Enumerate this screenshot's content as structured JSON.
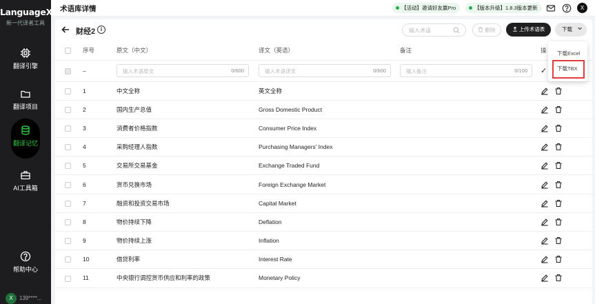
{
  "sidebar": {
    "logo": "LanguageX",
    "tagline": "新一代译者工具",
    "items": [
      {
        "label": "翻译引擎",
        "icon": "engine-icon"
      },
      {
        "label": "翻译项目",
        "icon": "folder-icon"
      },
      {
        "label": "翻译记忆",
        "icon": "database-icon"
      },
      {
        "label": "AI工具箱",
        "icon": "toolbox-icon"
      }
    ],
    "help": "帮助中心",
    "user": {
      "initial": "X",
      "name": "139****..."
    }
  },
  "topbar": {
    "title": "术语库详情",
    "pill1": "【活动】邀请好友赢Pro",
    "pill2": "【版本升级】1.8.3版本更新",
    "avatar": "X"
  },
  "page": {
    "title": "财经2"
  },
  "toolbar": {
    "search_placeholder": "输入术语",
    "delete_label": "删除",
    "upload_label": "上传术语表",
    "download_label": "下载"
  },
  "dropdown": {
    "excel": "下载Excel",
    "tbx": "下载TBX"
  },
  "table": {
    "headers": {
      "index": "序号",
      "source": "原文（中文）",
      "target": "译文（英语）",
      "note": "备注",
      "ops": "操"
    },
    "new_row": {
      "index": "–",
      "source_placeholder": "输入术语原文",
      "source_count": "0/600",
      "target_placeholder": "输入术语译文",
      "target_count": "0/600",
      "note_placeholder": "输入备注",
      "note_count": "0/100"
    },
    "rows": [
      {
        "index": "1",
        "source": "中文全称",
        "target": "英文全称"
      },
      {
        "index": "2",
        "source": "国内生产总值",
        "target": "Gross Domestic Product"
      },
      {
        "index": "3",
        "source": "消费者价格指数",
        "target": "Consumer Price Index"
      },
      {
        "index": "4",
        "source": "采购经理人指数",
        "target": "Purchasing Managers' Index"
      },
      {
        "index": "5",
        "source": "交易所交易基金",
        "target": "Exchange Traded Fund"
      },
      {
        "index": "6",
        "source": "货币兑换市场",
        "target": "Foreign Exchange Market"
      },
      {
        "index": "7",
        "source": "融资和投资交易市场",
        "target": "Capital Market"
      },
      {
        "index": "8",
        "source": "物价持续下降",
        "target": "Deflation"
      },
      {
        "index": "9",
        "source": "物价持续上涨",
        "target": "Inflation"
      },
      {
        "index": "10",
        "source": "借贷利率",
        "target": "Interest Rate"
      },
      {
        "index": "11",
        "source": "中央银行调控货币供应和利率的政策",
        "target": "Monetary Policy"
      }
    ]
  }
}
